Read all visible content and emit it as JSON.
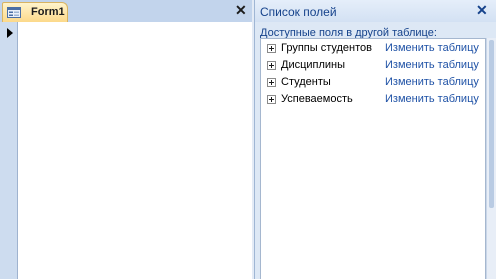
{
  "form": {
    "tab_title": "Form1",
    "tab_icon": "form-icon",
    "close_glyph": "✕",
    "record_indicator": "current-record-arrow"
  },
  "field_list": {
    "title": "Список полей",
    "close_glyph": "✕",
    "subtitle": "Доступные поля в другой таблице:",
    "tables": [
      {
        "name": "Группы студентов",
        "action": "Изменить таблицу"
      },
      {
        "name": "Дисциплины",
        "action": "Изменить таблицу"
      },
      {
        "name": "Студенты",
        "action": "Изменить таблицу"
      },
      {
        "name": "Успеваемость",
        "action": "Изменить таблицу"
      }
    ]
  },
  "colors": {
    "accent": "#15428b",
    "link": "#1f52a6",
    "tab_active": "#fcd98a"
  }
}
